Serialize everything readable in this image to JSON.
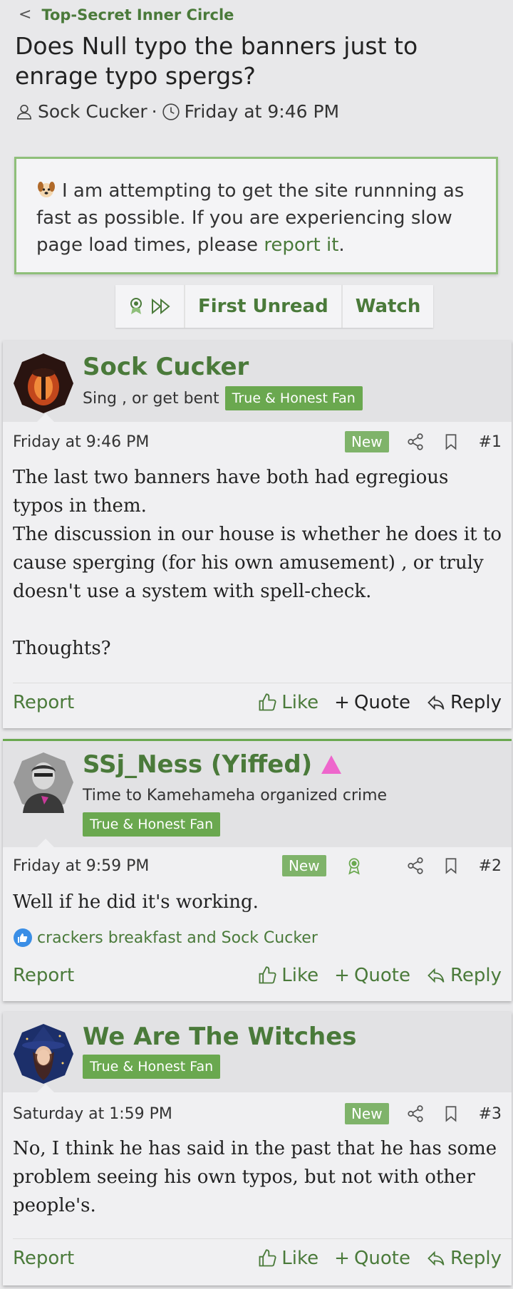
{
  "breadcrumb": {
    "forum": "Top-Secret Inner Circle"
  },
  "thread": {
    "title": "Does Null typo the banners just to enrage typo spergs?",
    "author": "Sock Cucker",
    "separator": "·",
    "date": "Friday at 9:46 PM"
  },
  "notice": {
    "text": "I am attempting to get the site runnning as fast as possible. If you are experiencing slow page load times, please ",
    "link": "report it",
    "end": "."
  },
  "pager": {
    "first_unread": "First Unread",
    "watch": "Watch"
  },
  "labels": {
    "report": "Report",
    "like": "Like",
    "quote": "Quote",
    "reply": "Reply",
    "new": "New"
  },
  "posts": [
    {
      "username": "Sock Cucker",
      "user_title": "Sing , or get bent",
      "badge": "True & Honest Fan",
      "date": "Friday at 9:46 PM",
      "number": "#1",
      "body": [
        "The last two banners have both had egregious typos in them.",
        "The discussion in our house is whether he does it to cause sperging (for his own amusement) , or truly doesn't use a system with spell-check.",
        "Thoughts?"
      ]
    },
    {
      "username": "SSj_Ness (Yiffed)",
      "user_title": "Time to Kamehameha organized crime",
      "badge": "True & Honest Fan",
      "date": "Friday at 9:59 PM",
      "number": "#2",
      "body": [
        "Well if he did it's working."
      ],
      "reactions": "crackers breakfast and Sock Cucker"
    },
    {
      "username": "We Are The Witches",
      "badge": "True & Honest Fan",
      "date": "Saturday at 1:59 PM",
      "number": "#3",
      "body": [
        "No, I think he has said in the past that he has some problem seeing his own typos, but not with other people's."
      ]
    }
  ],
  "colors": {
    "accent": "#4a7a3a",
    "badge": "#6aa84f",
    "new_badge": "#7fb36a",
    "username_marker": "#ee66cc"
  }
}
